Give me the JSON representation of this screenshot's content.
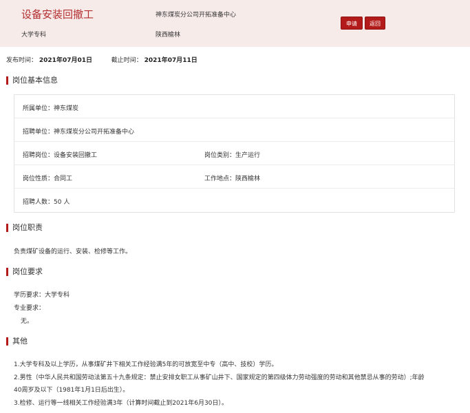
{
  "header": {
    "job_title": "设备安装回撤工",
    "education": "大学专科",
    "company": "神东煤炭分公司开拓准备中心",
    "location": "陕西榆林",
    "apply_label": "申请",
    "back_label": "返回"
  },
  "dates": {
    "publish_label": "发布时间：",
    "publish_value": "2021年07月01日",
    "deadline_label": "截止时间：",
    "deadline_value": "2021年07月11日"
  },
  "basic_info": {
    "heading": "岗位基本信息",
    "affiliation": "所属单位：神东煤炭",
    "recruiting_unit": "招聘单位：神东煤炭分公司开拓准备中心",
    "position": "招聘岗位：设备安装回撤工",
    "category": "岗位类别：生产运行",
    "nature": "岗位性质：合同工",
    "work_place": "工作地点：陕西榆林",
    "headcount": "招聘人数：50 人"
  },
  "duties": {
    "heading": "岗位职责",
    "text": "负责煤矿设备的运行、安装、检修等工作。"
  },
  "requirements": {
    "heading": "岗位要求",
    "education": "学历要求：大学专科",
    "major_label": "专业要求：",
    "major_value": "无。"
  },
  "others": {
    "heading": "其他",
    "lines": [
      "1.大学专科及以上学历，从事煤矿井下相关工作经验满5年的可放宽至中专（高中、技校）学历。",
      "2.男性（中华人民共和国劳动法第五十九条规定：禁止安排女职工从事矿山井下、国家规定的第四级体力劳动强度的劳动和其他禁忌从事的劳动）;年龄",
      "40周岁及以下（1981年1月1日后出生）。",
      "3.检修、运行等一线相关工作经验满3年（计算时间截止到2021年6月30日）。"
    ]
  },
  "colors": {
    "accent": "#b31b1b",
    "header_bg": "#f7ebea",
    "title_color": "#b32d2e"
  }
}
